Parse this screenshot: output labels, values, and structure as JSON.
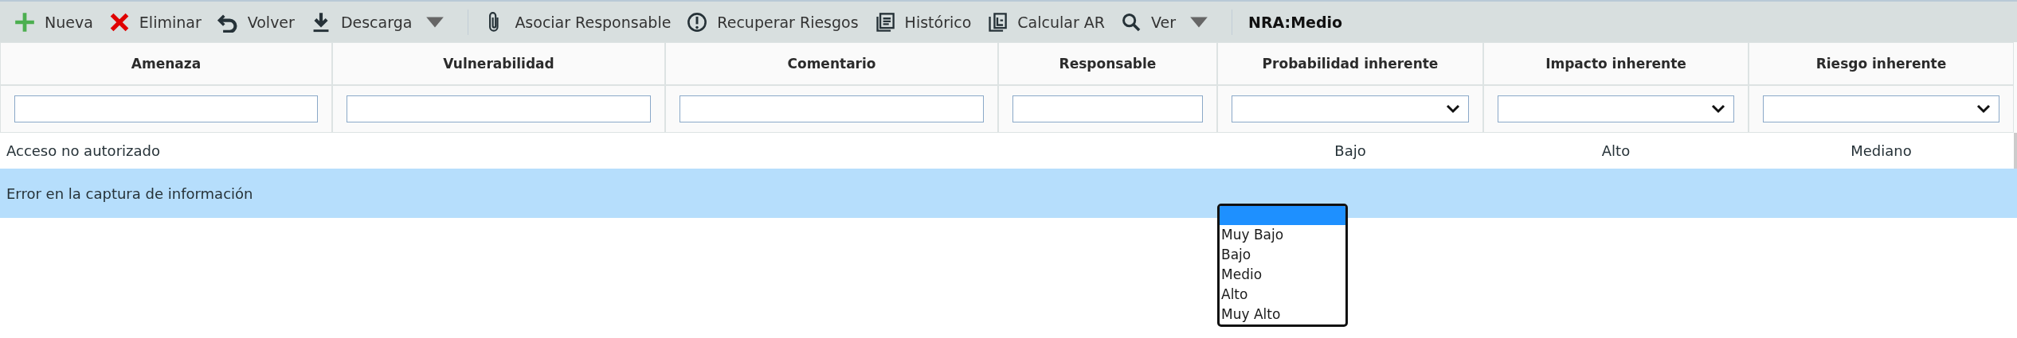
{
  "toolbar": [
    {
      "kind": "button",
      "label": "Nueva"
    },
    {
      "kind": "button",
      "label": "Eliminar"
    },
    {
      "kind": "button",
      "label": "Volver"
    },
    {
      "kind": "dropdown",
      "label": "Descarga"
    },
    {
      "kind": "separator"
    },
    {
      "kind": "button",
      "label": "Asociar Responsable"
    },
    {
      "kind": "button",
      "label": "Recuperar Riesgos"
    },
    {
      "kind": "button",
      "label": "Histórico"
    },
    {
      "kind": "button",
      "label": "Calcular AR"
    },
    {
      "kind": "dropdown",
      "label": "Ver"
    },
    {
      "kind": "separator"
    },
    {
      "kind": "label",
      "label": "NRA:Medio"
    }
  ],
  "table": {
    "columns": [
      {
        "title": "Amenaza",
        "filter": {
          "kind": "text"
        }
      },
      {
        "title": "Vulnerabilidad",
        "filter": {
          "kind": "text"
        }
      },
      {
        "title": "Comentario",
        "filter": {
          "kind": "text"
        }
      },
      {
        "title": "Responsable",
        "filter": {
          "kind": "text"
        }
      },
      {
        "title": "Probabilidad inherente",
        "filter": {
          "kind": "select"
        }
      },
      {
        "title": "Impacto inherente",
        "filter": {
          "kind": "select"
        }
      },
      {
        "title": "Riesgo inherente",
        "filter": {
          "kind": "select"
        }
      }
    ],
    "rows": [
      {
        "selected": false,
        "cells": [
          "Acceso no autorizado",
          "",
          "",
          "",
          "Bajo",
          "Alto",
          "Mediano"
        ]
      },
      {
        "selected": true,
        "cells": [
          "Error en la captura de información",
          "",
          "",
          "",
          "",
          "",
          ""
        ]
      }
    ]
  },
  "dropdown_list": {
    "blank_selected": true,
    "options": [
      {
        "label": "Muy Bajo",
        "selected": false
      },
      {
        "label": "Bajo",
        "selected": false
      },
      {
        "label": "Medio",
        "selected": false
      },
      {
        "label": "Alto",
        "selected": false
      },
      {
        "label": "Muy Alto",
        "selected": false
      }
    ]
  }
}
